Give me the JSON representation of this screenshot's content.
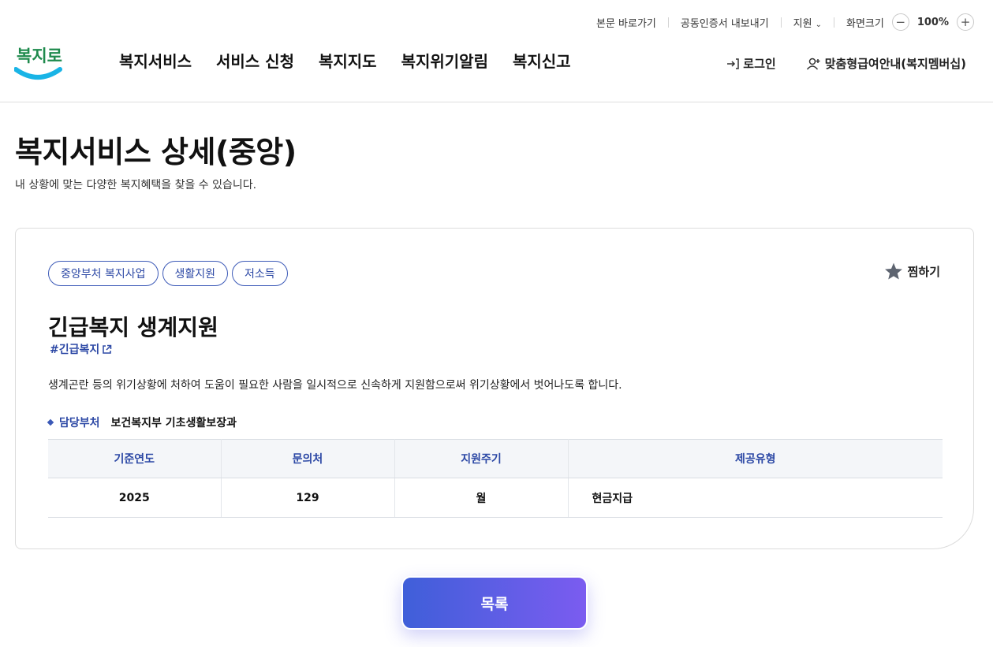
{
  "util": {
    "skip_link": "본문 바로가기",
    "cert_export": "공동인증서 내보내기",
    "support": "지원",
    "zoom_label": "화면크기",
    "zoom_value": "100%",
    "zoom_minus": "−",
    "zoom_plus": "+"
  },
  "header": {
    "logo_text": "복지로",
    "nav": [
      "복지서비스",
      "서비스 신청",
      "복지지도",
      "복지위기알림",
      "복지신고"
    ],
    "login": "로그인",
    "membership": "맞춤형급여안내(복지멤버십)"
  },
  "page": {
    "title": "복지서비스 상세(중앙)",
    "description": "내 상황에 맞는 다양한 복지혜택을 찾을 수 있습니다."
  },
  "service": {
    "tags": [
      "중앙부처 복지사업",
      "생활지원",
      "저소득"
    ],
    "favorite": "찜하기",
    "title": "긴급복지 생계지원",
    "hashtag": "#긴급복지",
    "description": "생계곤란 등의 위기상황에 처하여 도움이 필요한 사람을 일시적으로 신속하게 지원함으로써 위기상황에서 벗어나도록 합니다.",
    "dept_label": "담당부처",
    "dept_value": "보건복지부 기초생활보장과",
    "table": {
      "headers": [
        "기준연도",
        "문의처",
        "지원주기",
        "제공유형"
      ],
      "row": [
        "2025",
        "129",
        "월",
        "현금지급"
      ]
    }
  },
  "footer": {
    "list_button": "목록"
  },
  "colors": {
    "brand_blue": "#2c48a5",
    "button_gradient_start": "#3f5fd9",
    "button_gradient_end": "#7b5cf0",
    "logo_cyan": "#19b4e6"
  }
}
